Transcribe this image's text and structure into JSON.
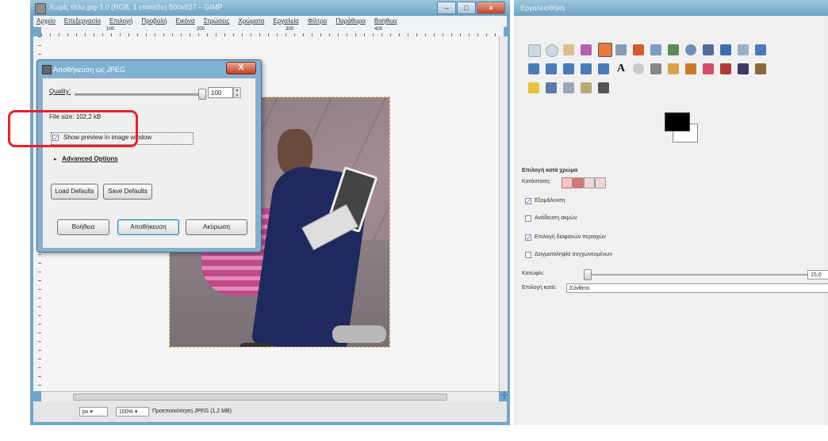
{
  "image_window": {
    "title": "Χωρίς τίτλο.jpg-3.0 (RGB, 1 επίπεδο) 500x627 – GIMP",
    "menu": [
      "Αρχείο",
      "Επεξεργασία",
      "Επιλογή",
      "Προβολή",
      "Εικόνα",
      "Στρώσεις",
      "Χρώματα",
      "Εργαλεία",
      "Φίλτρα",
      "Παράθυρα",
      "Βοήθεια"
    ],
    "ruler_marks": [
      "100",
      "200",
      "300",
      "400"
    ],
    "status": {
      "unit": "px",
      "zoom": "100%",
      "message": "Προεπισκόπηση JPEG (1,2 MB)"
    }
  },
  "dialog": {
    "title": "Αποθήκευση ως JPEG",
    "close": "X",
    "quality_label": "Quality:",
    "quality_value": "100",
    "file_size": "File size: 102,2 kB",
    "show_preview": "Show preview in image window",
    "show_preview_checked": true,
    "advanced": "Advanced Options",
    "load_defaults": "Load Defaults",
    "save_defaults": "Save Defaults",
    "help": "Βοήθεια",
    "save": "Αποθήκευση",
    "cancel": "Ακύρωση"
  },
  "toolbox": {
    "title": "Εργαλειοθήκη",
    "tool_name": "Επιλογή κατά χρώμα",
    "mode_label": "Κατάσταση:",
    "options": [
      {
        "label": "Εξομάλυνση",
        "checked": true
      },
      {
        "label": "Ανάδευση ακμών",
        "checked": false
      },
      {
        "label": "Επιλογή διαφανών περιοχών",
        "checked": true
      },
      {
        "label": "Δειγματοληψία συγχωνευμένων",
        "checked": false
      }
    ],
    "threshold_label": "Κατώφλι:",
    "threshold_value": "15,0",
    "select_by_label": "Επιλογή κατά:",
    "select_by_value": "Σύνθετο"
  },
  "colors": {
    "highlight": "#e8202a",
    "title_bar": "#6da2c4",
    "foreground": "#000000",
    "background": "#ffffff"
  }
}
